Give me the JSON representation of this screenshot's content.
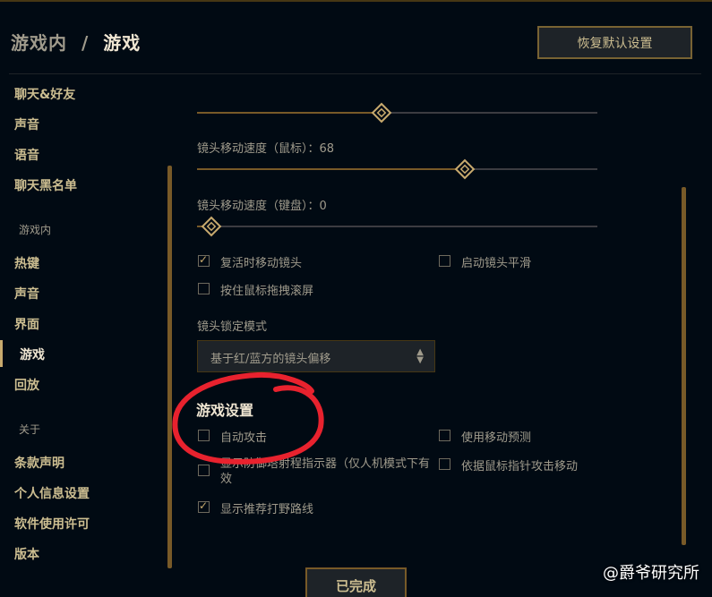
{
  "header": {
    "breadcrumb_parent": "游戏内",
    "breadcrumb_sep": "/",
    "breadcrumb_current": "游戏",
    "reset_label": "恢复默认设置"
  },
  "sidebar": {
    "top_items": [
      "聊天&好友",
      "声音",
      "语音",
      "聊天黑名单"
    ],
    "section_ingame": "游戏内",
    "ingame_items": [
      "热键",
      "声音",
      "界面",
      "游戏",
      "回放"
    ],
    "section_about": "关于",
    "about_items": [
      "条款声明",
      "个人信息设置",
      "软件使用许可",
      "版本"
    ]
  },
  "camera": {
    "mouse_speed_label": "镜头移动速度（鼠标）：68",
    "mouse_speed_value": 68,
    "keyboard_speed_label": "镜头移动速度（键盘）：0",
    "keyboard_speed_value": 0,
    "top_slider_fraction": 0.46,
    "mouse_slider_fraction": 0.67,
    "keyboard_slider_fraction": 0.035,
    "respawn_move_label": "复活时移动镜头",
    "respawn_move_checked": true,
    "smooth_label": "启动镜头平滑",
    "smooth_checked": false,
    "drag_scroll_label": "按住鼠标拖拽滚屏",
    "drag_scroll_checked": false,
    "lock_mode_label": "镜头锁定模式",
    "lock_mode_value": "基于红/蓝方的镜头偏移"
  },
  "game_settings": {
    "title": "游戏设置",
    "auto_attack_label": "自动攻击",
    "auto_attack_checked": false,
    "move_prediction_label": "使用移动预测",
    "move_prediction_checked": false,
    "range_indicator_label": "显示防御塔射程指示器（仅人机模式下有效",
    "range_indicator_checked": false,
    "cursor_attack_move_label": "依据鼠标指针攻击移动",
    "cursor_attack_move_checked": false,
    "jungle_path_label": "显示推荐打野路线",
    "jungle_path_checked": true
  },
  "footer": {
    "done_label": "已完成"
  },
  "watermark": "@爵爷研究所",
  "colors": {
    "gold": "#c8aa6e",
    "gold_dark": "#785a28",
    "background": "#010a13",
    "annotation_red": "#e8222e"
  }
}
